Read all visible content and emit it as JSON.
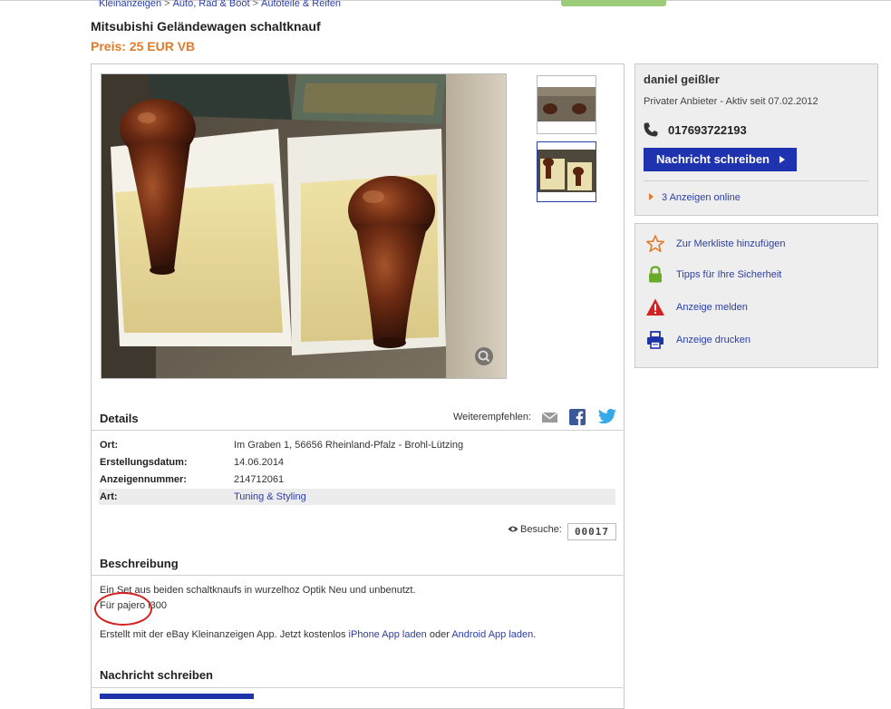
{
  "breadcrumb": [
    "Kleinanzeigen",
    "Auto, Rad & Boot",
    "Autoteile & Reifen"
  ],
  "breadcrumb_sep": ">",
  "listing": {
    "title": "Mitsubishi Geländewagen schaltknauf",
    "price": "Preis: 25 EUR VB"
  },
  "gallery": {
    "main_image": "wooden-gear-knobs-photo",
    "thumbnails": [
      "thumbnail-1",
      "thumbnail-2"
    ],
    "selected_thumbnail": 2
  },
  "details": {
    "heading": "Details",
    "share_label": "Weiterempfehlen:",
    "share_icons": [
      "email-icon",
      "facebook-icon",
      "twitter-icon"
    ],
    "rows": [
      {
        "label": "Ort:",
        "value": "Im Graben 1, 56656 Rheinland-Pfalz - Brohl-Lützing"
      },
      {
        "label": "Erstellungsdatum:",
        "value": "14.06.2014"
      },
      {
        "label": "Anzeigennummer:",
        "value": "214712061"
      },
      {
        "label": "Art:",
        "value": "Tuning & Styling"
      }
    ],
    "visits_label": "Besuche:",
    "visits_count": "00017"
  },
  "description": {
    "heading": "Beschreibung",
    "line1": "Ein Set aus beiden schaltknaufs in wurzelhoz Optik Neu und unbenutzt.",
    "line2": "Für pajero l300",
    "app_prefix": "Erstellt mit der eBay Kleinanzeigen App. Jetzt kostenlos ",
    "iphone_link": "iPhone App laden",
    "app_middle": " oder ",
    "android_link": "Android App laden",
    "app_suffix": "."
  },
  "message_section": {
    "heading": "Nachricht schreiben"
  },
  "seller": {
    "name": "daniel geißler",
    "info": "Privater Anbieter - Aktiv seit 07.02.2012",
    "phone": "017693722193",
    "message_button": "Nachricht schreiben",
    "ads_online": "3 Anzeigen online"
  },
  "actions": [
    {
      "label": "Zur Merkliste hinzufügen",
      "icon": "star-icon"
    },
    {
      "label": "Tipps für Ihre Sicherheit",
      "icon": "lock-icon"
    },
    {
      "label": "Anzeige melden",
      "icon": "warning-icon"
    },
    {
      "label": "Anzeige drucken",
      "icon": "printer-icon"
    }
  ],
  "colors": {
    "price": "#e07a2a",
    "link": "#2a3ea8",
    "button": "#1f33b0",
    "highlight_circle": "#d42222"
  }
}
